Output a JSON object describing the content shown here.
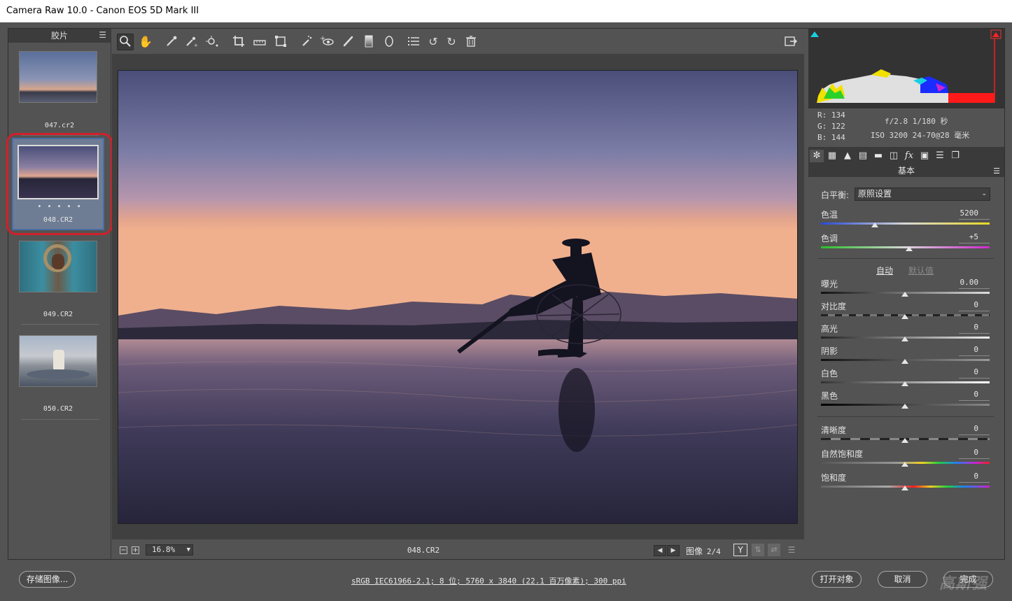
{
  "window": {
    "title": "Camera Raw 10.0 -  Canon EOS 5D Mark III"
  },
  "filmstrip": {
    "header": "胶片",
    "items": [
      {
        "label": "047.cr2",
        "rating": ""
      },
      {
        "label": "048.CR2",
        "rating": "• • • • •"
      },
      {
        "label": "049.CR2",
        "rating": ""
      },
      {
        "label": "050.CR2",
        "rating": ""
      }
    ]
  },
  "bottom_bar": {
    "zoom": "16.8%",
    "filename": "048.CR2",
    "image_label": "图像",
    "image_count": "2/4"
  },
  "histogram": {
    "r": "R: 134",
    "g": "G: 122",
    "b": "B: 144",
    "aperture_shutter": "f/2.8  1/180 秒",
    "iso_lens": "ISO 3200  24-70@28 毫米"
  },
  "basic_panel": {
    "title": "基本",
    "white_balance_label": "白平衡:",
    "white_balance_value": "原照设置",
    "temp_label": "色温",
    "temp_value": "5200",
    "tint_label": "色调",
    "tint_value": "+5",
    "auto_link": "自动",
    "default_link": "默认值",
    "exposure_label": "曝光",
    "exposure_value": "0.00",
    "contrast_label": "对比度",
    "contrast_value": "0",
    "highlights_label": "高光",
    "highlights_value": "0",
    "shadows_label": "阴影",
    "shadows_value": "0",
    "whites_label": "白色",
    "whites_value": "0",
    "blacks_label": "黑色",
    "blacks_value": "0",
    "clarity_label": "清晰度",
    "clarity_value": "0",
    "vibrance_label": "自然饱和度",
    "vibrance_value": "0",
    "saturation_label": "饱和度",
    "saturation_value": "0"
  },
  "footer": {
    "save_button": "存储图像...",
    "workflow_link": "sRGB IEC61966-2.1; 8 位; 5760 x 3840 (22.1 百万像素); 300 ppi",
    "open_button": "打开对象",
    "cancel_button": "取消",
    "done_button": "完成",
    "watermark": "高斯强"
  },
  "colors": {
    "panel_bg": "#535353",
    "canvas_bg": "#404040",
    "selection_blue": "#4b6ea8",
    "annotation_red": "#d0202a"
  }
}
